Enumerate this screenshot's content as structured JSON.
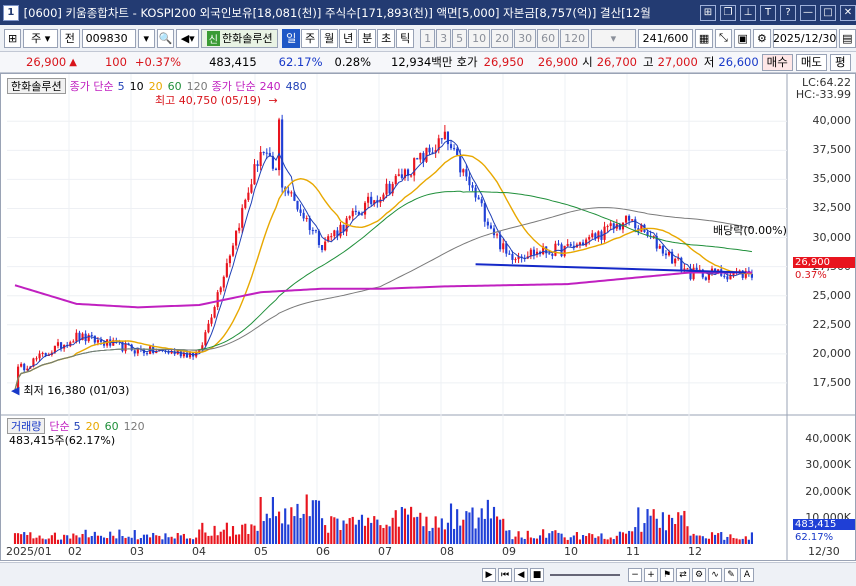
{
  "titlebar": {
    "num": "1",
    "title": "[0600] 키움종합차트 - KOSPI200 외국인보유[18,081(천)] 주식수[171,893(천)] 액면[5,000] 자본금[8,757(억)] 결산[12월",
    "btn_icons": [
      "window-icon",
      "restore-icon",
      "pin-icon",
      "font-icon",
      "help-icon",
      "minimize-icon",
      "maximize-icon",
      "close-icon"
    ],
    "btn_glyphs": [
      "⊞",
      "❐",
      "⊥",
      "T",
      "?",
      "—",
      "□",
      "✕"
    ]
  },
  "toolbar": {
    "market": "주",
    "market_sub": "전",
    "code": "009830",
    "name_badge": "신",
    "name": "한화솔루션",
    "periods": [
      "일",
      "주",
      "월",
      "년",
      "분",
      "초",
      "틱"
    ],
    "active_period": "일",
    "intervals": [
      "1",
      "3",
      "5",
      "10",
      "20",
      "30",
      "60",
      "120"
    ],
    "count": "241",
    "count_total": "/600",
    "date": "2025/12/30"
  },
  "quote": {
    "price": "26,900",
    "arrow": "▲",
    "change": "100",
    "change_pct": "+0.37%",
    "volume": "483,415",
    "vol_ratio": "62.17%",
    "turnover": "0.28%",
    "amount": "12,934백만",
    "hoga_label": "호가",
    "ask": "26,950",
    "bid": "26,900",
    "open_label": "시",
    "open": "26,700",
    "high_label": "고",
    "high": "27,000",
    "low_label": "저",
    "low": "26,600",
    "buy": "매수",
    "sell": "매도",
    "eval": "평"
  },
  "price_panel": {
    "name_tag": "한화솔루션",
    "ma_label": "종가 단순",
    "ma_periods": [
      "5",
      "10",
      "20",
      "60",
      "120"
    ],
    "ma2_label": "종가 단순",
    "ma2_periods": [
      "240",
      "480"
    ],
    "high_note": "최고 40,750 (05/19)",
    "low_note": "최저 16,380 (01/03)",
    "dividend_note": "배당락(0.00%)",
    "lc": "LC:64.22",
    "hc": "HC:-33.99",
    "y_ticks": [
      "40,000",
      "37,500",
      "35,000",
      "32,500",
      "30,000",
      "27,500",
      "25,000",
      "22,500",
      "20,000",
      "17,500"
    ],
    "price_tag": "26,900",
    "pct_tag": "0.37%"
  },
  "volume_panel": {
    "title": "거래량",
    "ma_label": "단순",
    "ma_periods": [
      "5",
      "20",
      "60",
      "120"
    ],
    "summary": "483,415주(62.17%)",
    "y_ticks": [
      "40,000K",
      "30,000K",
      "20,000K",
      "10,000K"
    ],
    "vol_tag": "483,415",
    "pct_tag": "62.17%"
  },
  "x_labels": [
    "2025/01",
    "02",
    "03",
    "04",
    "05",
    "06",
    "07",
    "08",
    "09",
    "10",
    "11",
    "12",
    "12/30"
  ],
  "colors": {
    "up": "#e8141e",
    "down": "#1f3fd6",
    "ma5": "#1f3fb6",
    "ma20": "#e8a800",
    "ma60": "#1f8f3a",
    "ma120": "#7a7a7a",
    "ma240": "#c020c0",
    "trendline": "#1428c8"
  },
  "chart_data": {
    "type": "candlestick",
    "x": [
      "2025/01",
      "02",
      "03",
      "04",
      "05",
      "06",
      "07",
      "08",
      "09",
      "10",
      "11",
      "12"
    ],
    "close": [
      18500,
      21500,
      20300,
      20000,
      37500,
      29500,
      34000,
      38500,
      28500,
      29000,
      31500,
      26900
    ],
    "high_point": {
      "date": "05/19",
      "value": 40750
    },
    "low_point": {
      "date": "01/03",
      "value": 16380
    },
    "ma240": [
      25900,
      24300,
      24000,
      24200,
      25300,
      25600,
      25600,
      25800,
      25900,
      26000,
      26500,
      27000
    ],
    "volume_k": [
      5000,
      6000,
      4500,
      9000,
      20000,
      12000,
      15000,
      18000,
      6000,
      5000,
      15000,
      5000
    ],
    "ylim": [
      15000,
      42000
    ],
    "volume_ylim": [
      0,
      45000
    ]
  }
}
